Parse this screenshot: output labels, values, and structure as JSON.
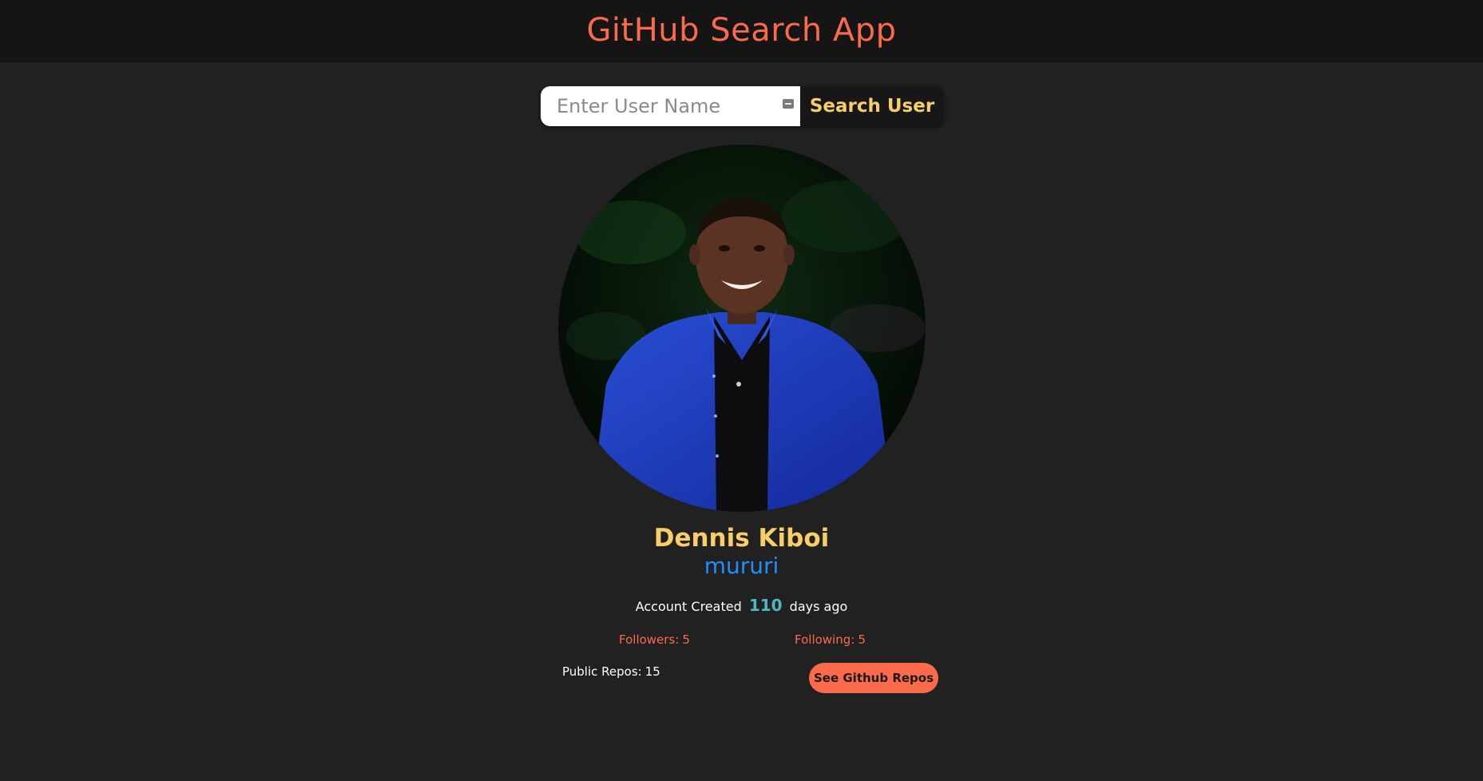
{
  "header": {
    "title": "GitHub Search App"
  },
  "search": {
    "placeholder": "Enter User Name",
    "value": "",
    "button_label": "Search User"
  },
  "profile": {
    "name": "Dennis Kiboi",
    "login": "mururi",
    "created_prefix": "Account Created",
    "created_days": "110",
    "created_suffix": "days ago",
    "followers_label": "Followers:",
    "followers_count": "5",
    "following_label": "Following:",
    "following_count": "5",
    "repos_label": "Public Repos:",
    "repos_count": "15",
    "repos_button_label": "See Github Repos"
  },
  "colors": {
    "accent": "#fa6a4b",
    "name": "#f7ce68",
    "login": "#1e90ff",
    "days": "#4fb7c2",
    "background": "#212121",
    "header_background": "#151515"
  },
  "icons": {
    "avatar": "profile-photo",
    "input_key": "password-manager-key-icon"
  }
}
